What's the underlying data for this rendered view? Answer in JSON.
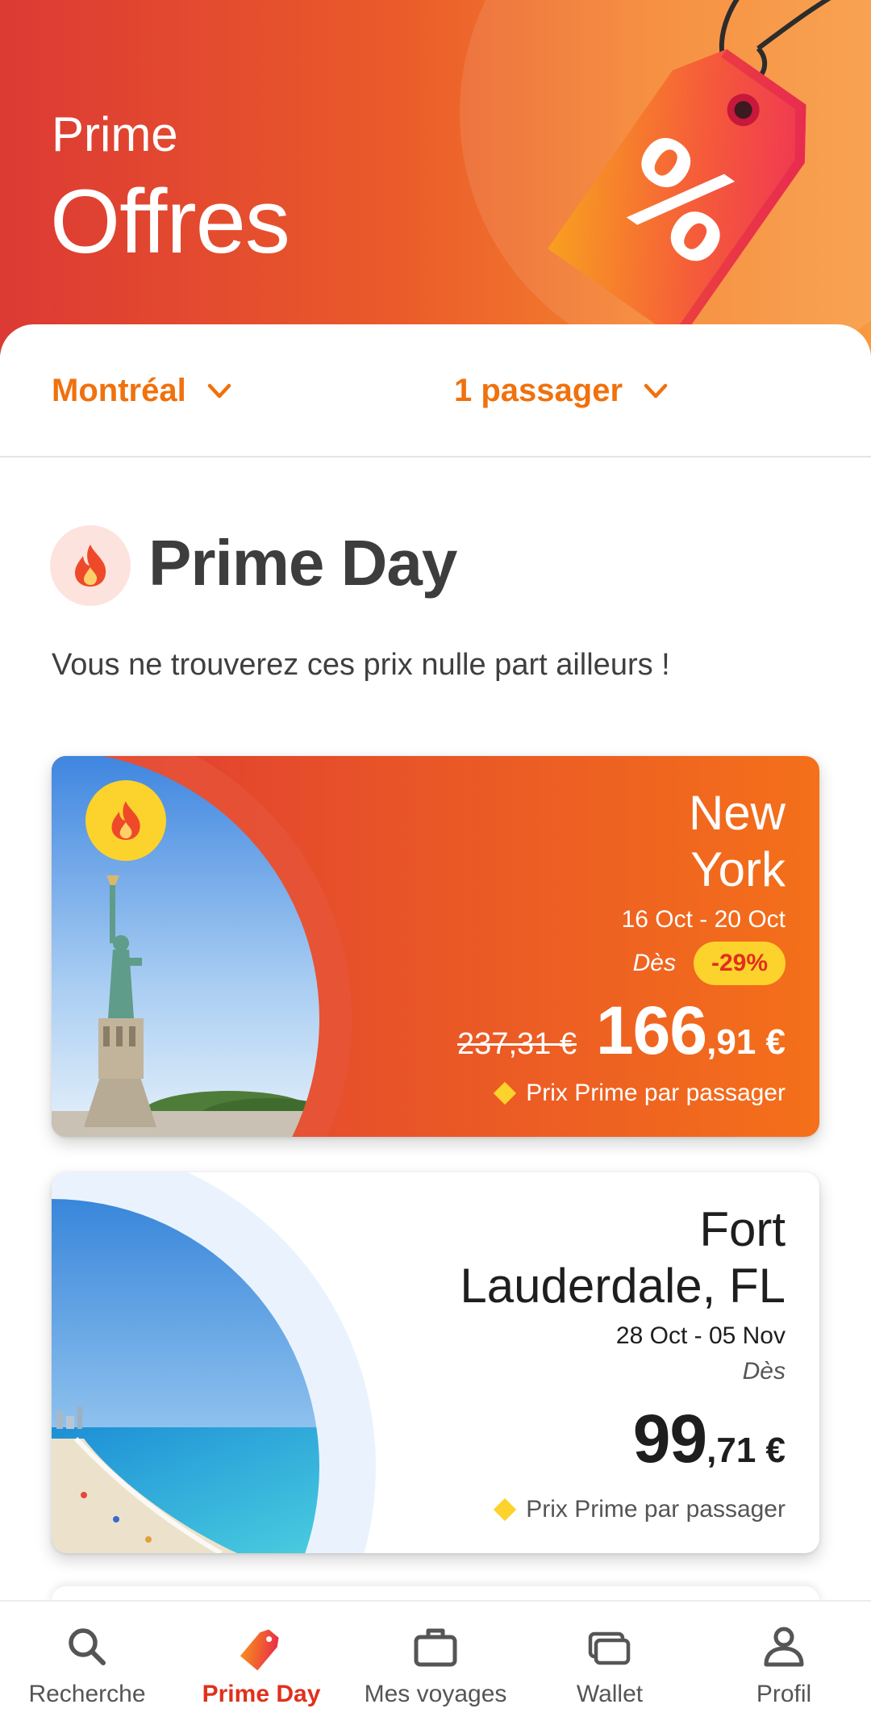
{
  "header": {
    "subtitle": "Prime",
    "title": "Offres"
  },
  "filters": {
    "origin": "Montréal",
    "passengers": "1 passager"
  },
  "section": {
    "title": "Prime Day",
    "description": "Vous ne trouverez ces prix nulle part ailleurs !"
  },
  "offers": [
    {
      "destination_line1": "New",
      "destination_line2": "York",
      "dates": "16 Oct - 20 Oct",
      "from_label": "Dès",
      "discount": "-29%",
      "old_price": "237,31 €",
      "price_whole": "166",
      "price_fraction": ",91 €",
      "note": "Prix Prime par passager"
    },
    {
      "destination_line1": "Fort",
      "destination_line2": "Lauderdale, FL",
      "dates": "28 Oct - 05 Nov",
      "from_label": "Dès",
      "price_whole": "99",
      "price_fraction": ",71 €",
      "note": "Prix Prime par passager"
    }
  ],
  "nav": [
    {
      "label": "Recherche",
      "icon": "search-icon"
    },
    {
      "label": "Prime Day",
      "icon": "price-tag-icon",
      "active": true
    },
    {
      "label": "Mes voyages",
      "icon": "suitcase-icon"
    },
    {
      "label": "Wallet",
      "icon": "wallet-icon"
    },
    {
      "label": "Profil",
      "icon": "profile-icon"
    }
  ],
  "colors": {
    "accent": "#f0710d",
    "active_nav": "#e0301c",
    "badge_yellow": "#fcd22c"
  }
}
